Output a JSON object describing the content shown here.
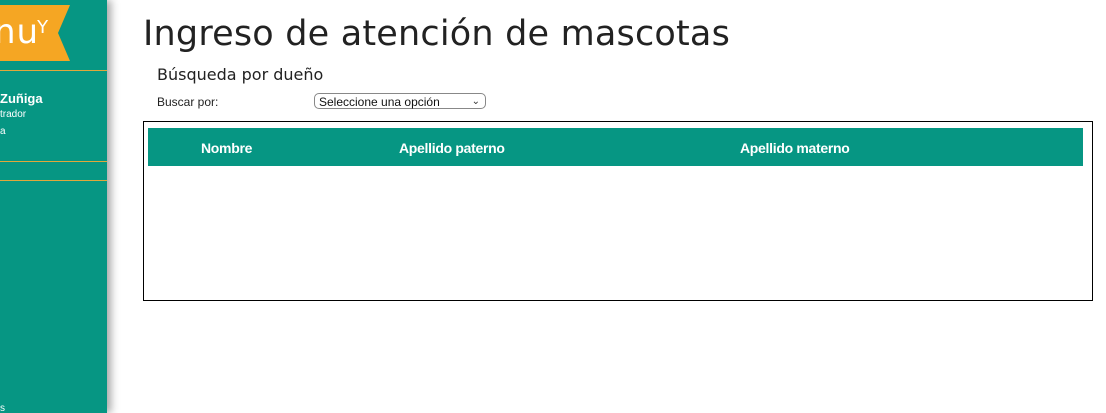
{
  "sidebar": {
    "logo_text": "nu",
    "logo_sprout": "Y",
    "user_name": "Zuñiga",
    "user_role": "trador",
    "user_extra": "a",
    "bottom_text": "s",
    "colors": {
      "background": "#069683",
      "logo": "#f5a623",
      "divider": "#e0a83a"
    }
  },
  "main": {
    "title": "Ingreso de atención de mascotas",
    "section_title": "Búsqueda por dueño",
    "search": {
      "label": "Buscar por:",
      "select_value": "Seleccione una opción"
    },
    "table": {
      "columns": [
        "Nombre",
        "Apellido paterno",
        "Apellido materno"
      ],
      "rows": [],
      "header_color": "#069683"
    }
  }
}
